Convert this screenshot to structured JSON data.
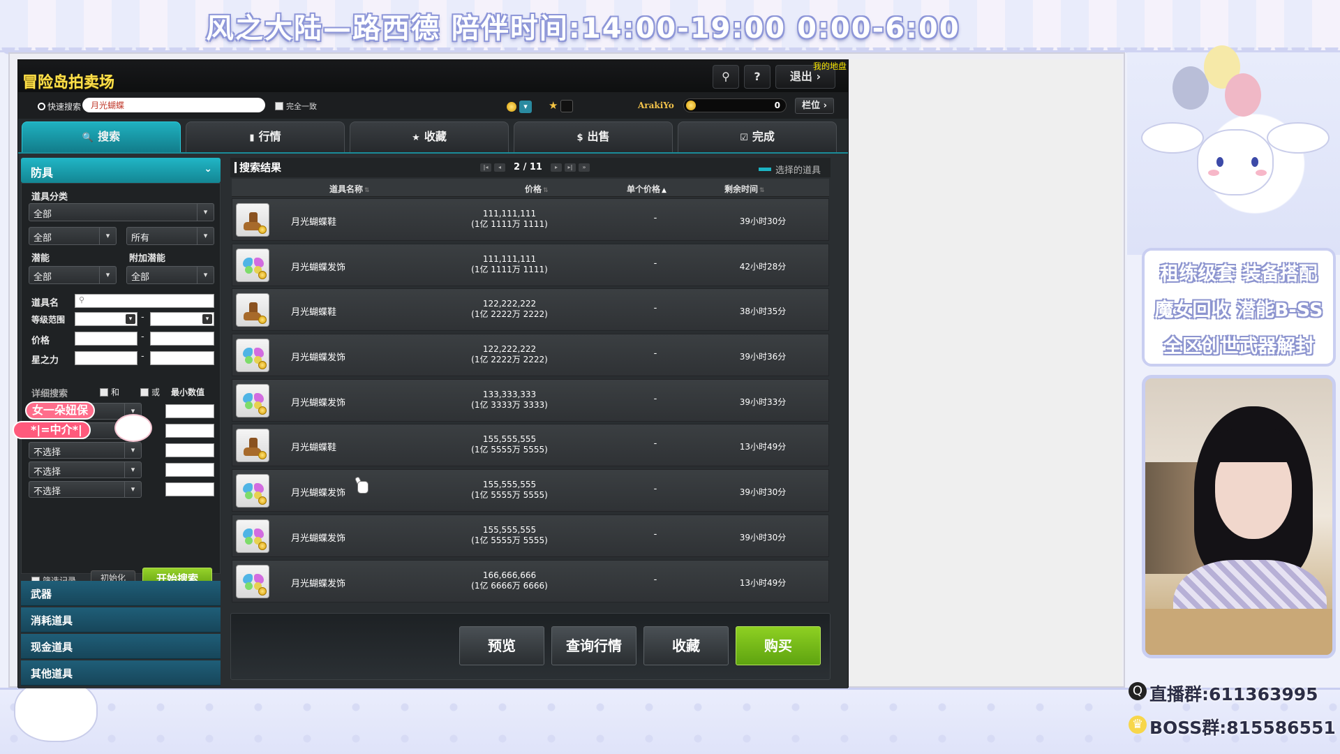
{
  "overlay": {
    "stream_title": "风之大陆—路西德   陪伴时间:14:00-19:00  0:00-6:00",
    "promo_lines": [
      "租练级套  装备搭配",
      "魔女回收  潜能B-SS",
      "全区创世武器解封"
    ],
    "group_lines": [
      "直播群:611363995",
      "BOSS群:815586551"
    ],
    "sticker_line1": "女一朵妞保",
    "sticker_line2": "*|=中介*|"
  },
  "window": {
    "title": "冒险岛拍卖场",
    "my_land_link": "我的地盘",
    "exit_label": "退出",
    "question_label": "?",
    "user_icon_label": "⚲"
  },
  "search_bar": {
    "quick_search_label": "快速搜索",
    "quick_search_value": "月光蝴蝶",
    "exact_match_label": "完全一致",
    "username": "ArakiYo",
    "meso_amount": "0",
    "slot_label": "栏位"
  },
  "tabs": [
    {
      "label": "搜索",
      "icon": "🔍",
      "active": true
    },
    {
      "label": "行情",
      "icon": "▮",
      "active": false
    },
    {
      "label": "收藏",
      "icon": "★",
      "active": false
    },
    {
      "label": "出售",
      "icon": "$",
      "active": false
    },
    {
      "label": "完成",
      "icon": "☑",
      "active": false
    }
  ],
  "filter": {
    "category_title": "防具",
    "item_category_label": "道具分类",
    "category_select": "全部",
    "sub_select_1": "全部",
    "sub_select_2": "所有",
    "potential_label": "潜能",
    "extra_potential_label": "附加潜能",
    "potential_select": "全部",
    "extra_potential_select": "全部",
    "item_name_label": "道具名",
    "level_range_label": "等级范围",
    "price_label": "价格",
    "star_force_label": "星之力",
    "detail_search_label": "详细搜索",
    "and_label": "和",
    "or_label": "或",
    "min_value_label": "最小数值",
    "option_selects": [
      "不选择",
      "不选择",
      "不选择",
      "不选择",
      "不选择"
    ],
    "filter_record_label": "筛选记录",
    "reset_label": "初始化",
    "start_search_label": "开始搜索",
    "dash": "-"
  },
  "categories": [
    "武器",
    "消耗道具",
    "现金道具",
    "其他道具"
  ],
  "results": {
    "title": "搜索结果",
    "page_current": "2",
    "page_total": "11",
    "page_separator": "/",
    "selected_legend": "选择的道具",
    "columns": {
      "name": "道具名称",
      "price": "价格",
      "unit_price": "单个价格",
      "remaining": "剩余时间"
    },
    "rows": [
      {
        "type": "shoe",
        "name": "月光蝴蝶鞋",
        "price": "111,111,111",
        "price_cn": "(1亿 1111万 1111)",
        "unit": "-",
        "time": "39小时30分"
      },
      {
        "type": "butterfly",
        "name": "月光蝴蝶发饰",
        "price": "111,111,111",
        "price_cn": "(1亿 1111万 1111)",
        "unit": "-",
        "time": "42小时28分"
      },
      {
        "type": "shoe",
        "name": "月光蝴蝶鞋",
        "price": "122,222,222",
        "price_cn": "(1亿 2222万 2222)",
        "unit": "-",
        "time": "38小时35分"
      },
      {
        "type": "butterfly",
        "name": "月光蝴蝶发饰",
        "price": "122,222,222",
        "price_cn": "(1亿 2222万 2222)",
        "unit": "-",
        "time": "39小时36分"
      },
      {
        "type": "butterfly",
        "name": "月光蝴蝶发饰",
        "price": "133,333,333",
        "price_cn": "(1亿 3333万 3333)",
        "unit": "-",
        "time": "39小时33分"
      },
      {
        "type": "shoe",
        "name": "月光蝴蝶鞋",
        "price": "155,555,555",
        "price_cn": "(1亿 5555万 5555)",
        "unit": "-",
        "time": "13小时49分"
      },
      {
        "type": "butterfly",
        "name": "月光蝴蝶发饰",
        "price": "155,555,555",
        "price_cn": "(1亿 5555万 5555)",
        "unit": "-",
        "time": "39小时30分"
      },
      {
        "type": "butterfly",
        "name": "月光蝴蝶发饰",
        "price": "155,555,555",
        "price_cn": "(1亿 5555万 5555)",
        "unit": "-",
        "time": "39小时30分"
      },
      {
        "type": "butterfly",
        "name": "月光蝴蝶发饰",
        "price": "166,666,666",
        "price_cn": "(1亿 6666万 6666)",
        "unit": "-",
        "time": "13小时49分"
      }
    ]
  },
  "actions": {
    "preview": "预览",
    "market": "查询行情",
    "favorite": "收藏",
    "buy": "购买"
  },
  "colors": {
    "accent_teal": "#1fb1c0",
    "buy_green": "#8ed022",
    "title_yellow": "#ffe14a"
  }
}
